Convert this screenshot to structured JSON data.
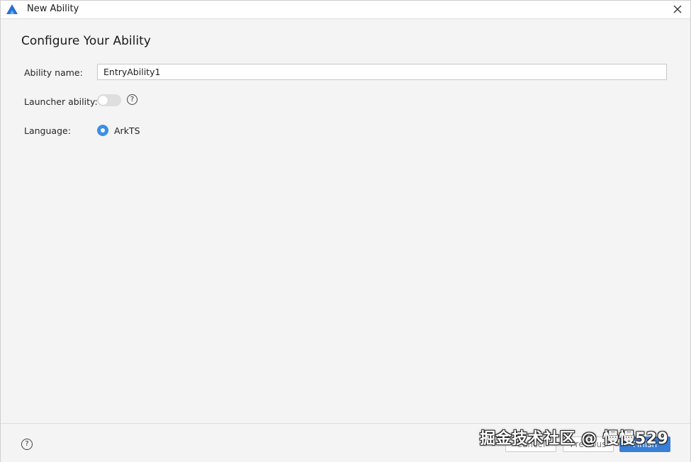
{
  "window": {
    "title": "New Ability",
    "close_glyph": "✕"
  },
  "page": {
    "heading": "Configure Your Ability"
  },
  "form": {
    "ability_name_label": "Ability name:",
    "ability_name_value": "EntryAbility1",
    "launcher_label": "Launcher ability:",
    "launcher_enabled": false,
    "language_label": "Language:",
    "language_option": "ArkTS",
    "language_selected": true
  },
  "help_glyph": "?",
  "footer": {
    "cancel_label": "Cancel",
    "previous_label": "Previous",
    "finish_label": "Finish"
  },
  "watermark": "掘金技术社区 @ 慢慢529",
  "colors": {
    "accent": "#3a7fd6",
    "radio": "#3c8ee8",
    "background": "#f4f4f4",
    "toggle_off": "#dedede"
  },
  "icons": {
    "app": "harmony-deveco-logo-icon",
    "close": "close-icon",
    "help": "help-icon",
    "footer_help": "help-icon"
  }
}
